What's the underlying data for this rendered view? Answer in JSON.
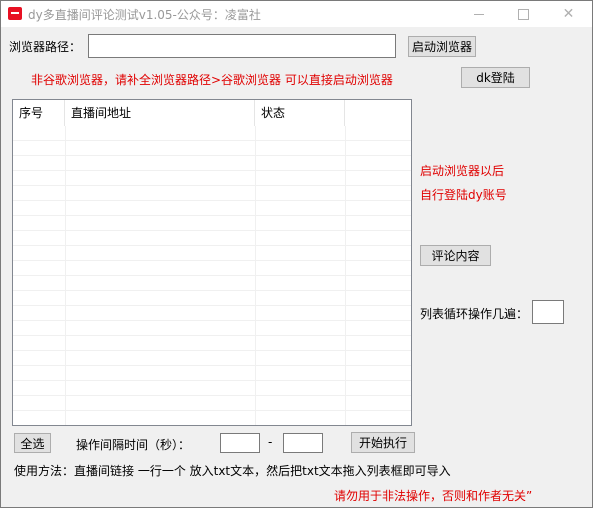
{
  "window": {
    "title": "dy多直播间评论测试v1.05-公众号：凌富社",
    "minimize_icon": "minimize-icon",
    "maximize_icon": "maximize-icon",
    "close_icon": "close-icon"
  },
  "browser": {
    "path_label": "浏览器路径：",
    "path_value": "",
    "launch_button": "启动浏览器",
    "notice": "非谷歌浏览器，请补全浏览器路径>谷歌浏览器 可以直接启动浏览器",
    "login_button": "dk登陆"
  },
  "table": {
    "columns": [
      "序号",
      "直播间地址",
      "状态"
    ],
    "rows": []
  },
  "side": {
    "hint_line1": "启动浏览器以后",
    "hint_line2": "自行登陆dy账号",
    "comment_button": "评论内容",
    "loop_label": "列表循环操作几遍：",
    "loop_value": ""
  },
  "bottom": {
    "select_all_button": "全选",
    "interval_label": "操作间隔时间（秒）：",
    "interval_min": "",
    "dash": "-",
    "interval_max": "",
    "start_button": "开始执行",
    "usage": "使用方法：直播间链接 一行一个 放入txt文本，然后把txt文本拖入列表框即可导入",
    "warning": "请勿用于非法操作，否则和作者无关”"
  },
  "colors": {
    "accent_red": "#e00000",
    "title_grey": "#999999"
  }
}
